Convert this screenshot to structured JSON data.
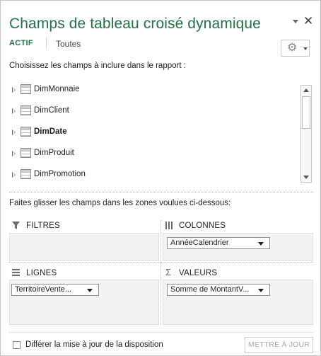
{
  "pane": {
    "title": "Champs de tableau croisé dynamique",
    "close_glyph": "✕",
    "tabs": {
      "active": "ACTIF",
      "all": "Toutes"
    },
    "gear_glyph": "⚙"
  },
  "fields_section": {
    "prompt": "Choisissez les champs à inclure dans le rapport :",
    "fields": [
      {
        "label": "DimMonnaie",
        "bold": false
      },
      {
        "label": "DimClient",
        "bold": false
      },
      {
        "label": "DimDate",
        "bold": true
      },
      {
        "label": "DimProduit",
        "bold": false
      },
      {
        "label": "DimPromotion",
        "bold": false
      }
    ]
  },
  "areas_section": {
    "prompt": "Faites glisser les champs dans les zones voulues ci-dessous:",
    "filters": {
      "title": "FILTRES",
      "icon": "filter-icon"
    },
    "columns": {
      "title": "COLONNES",
      "icon": "columns-icon",
      "items": [
        "AnnéeCalendrier"
      ]
    },
    "rows": {
      "title": "LIGNES",
      "icon": "rows-icon",
      "items": [
        "TerritoireVente..."
      ]
    },
    "values": {
      "title": "VALEURS",
      "icon": "sigma-icon",
      "icon_glyph": "Σ",
      "items": [
        "Somme de MontantV..."
      ]
    }
  },
  "footer": {
    "defer_label": "Différer la mise à jour de la disposition",
    "update_button": "METTRE À JOUR"
  },
  "colors": {
    "accent": "#217346",
    "disabled_text": "#a8a8a8"
  }
}
